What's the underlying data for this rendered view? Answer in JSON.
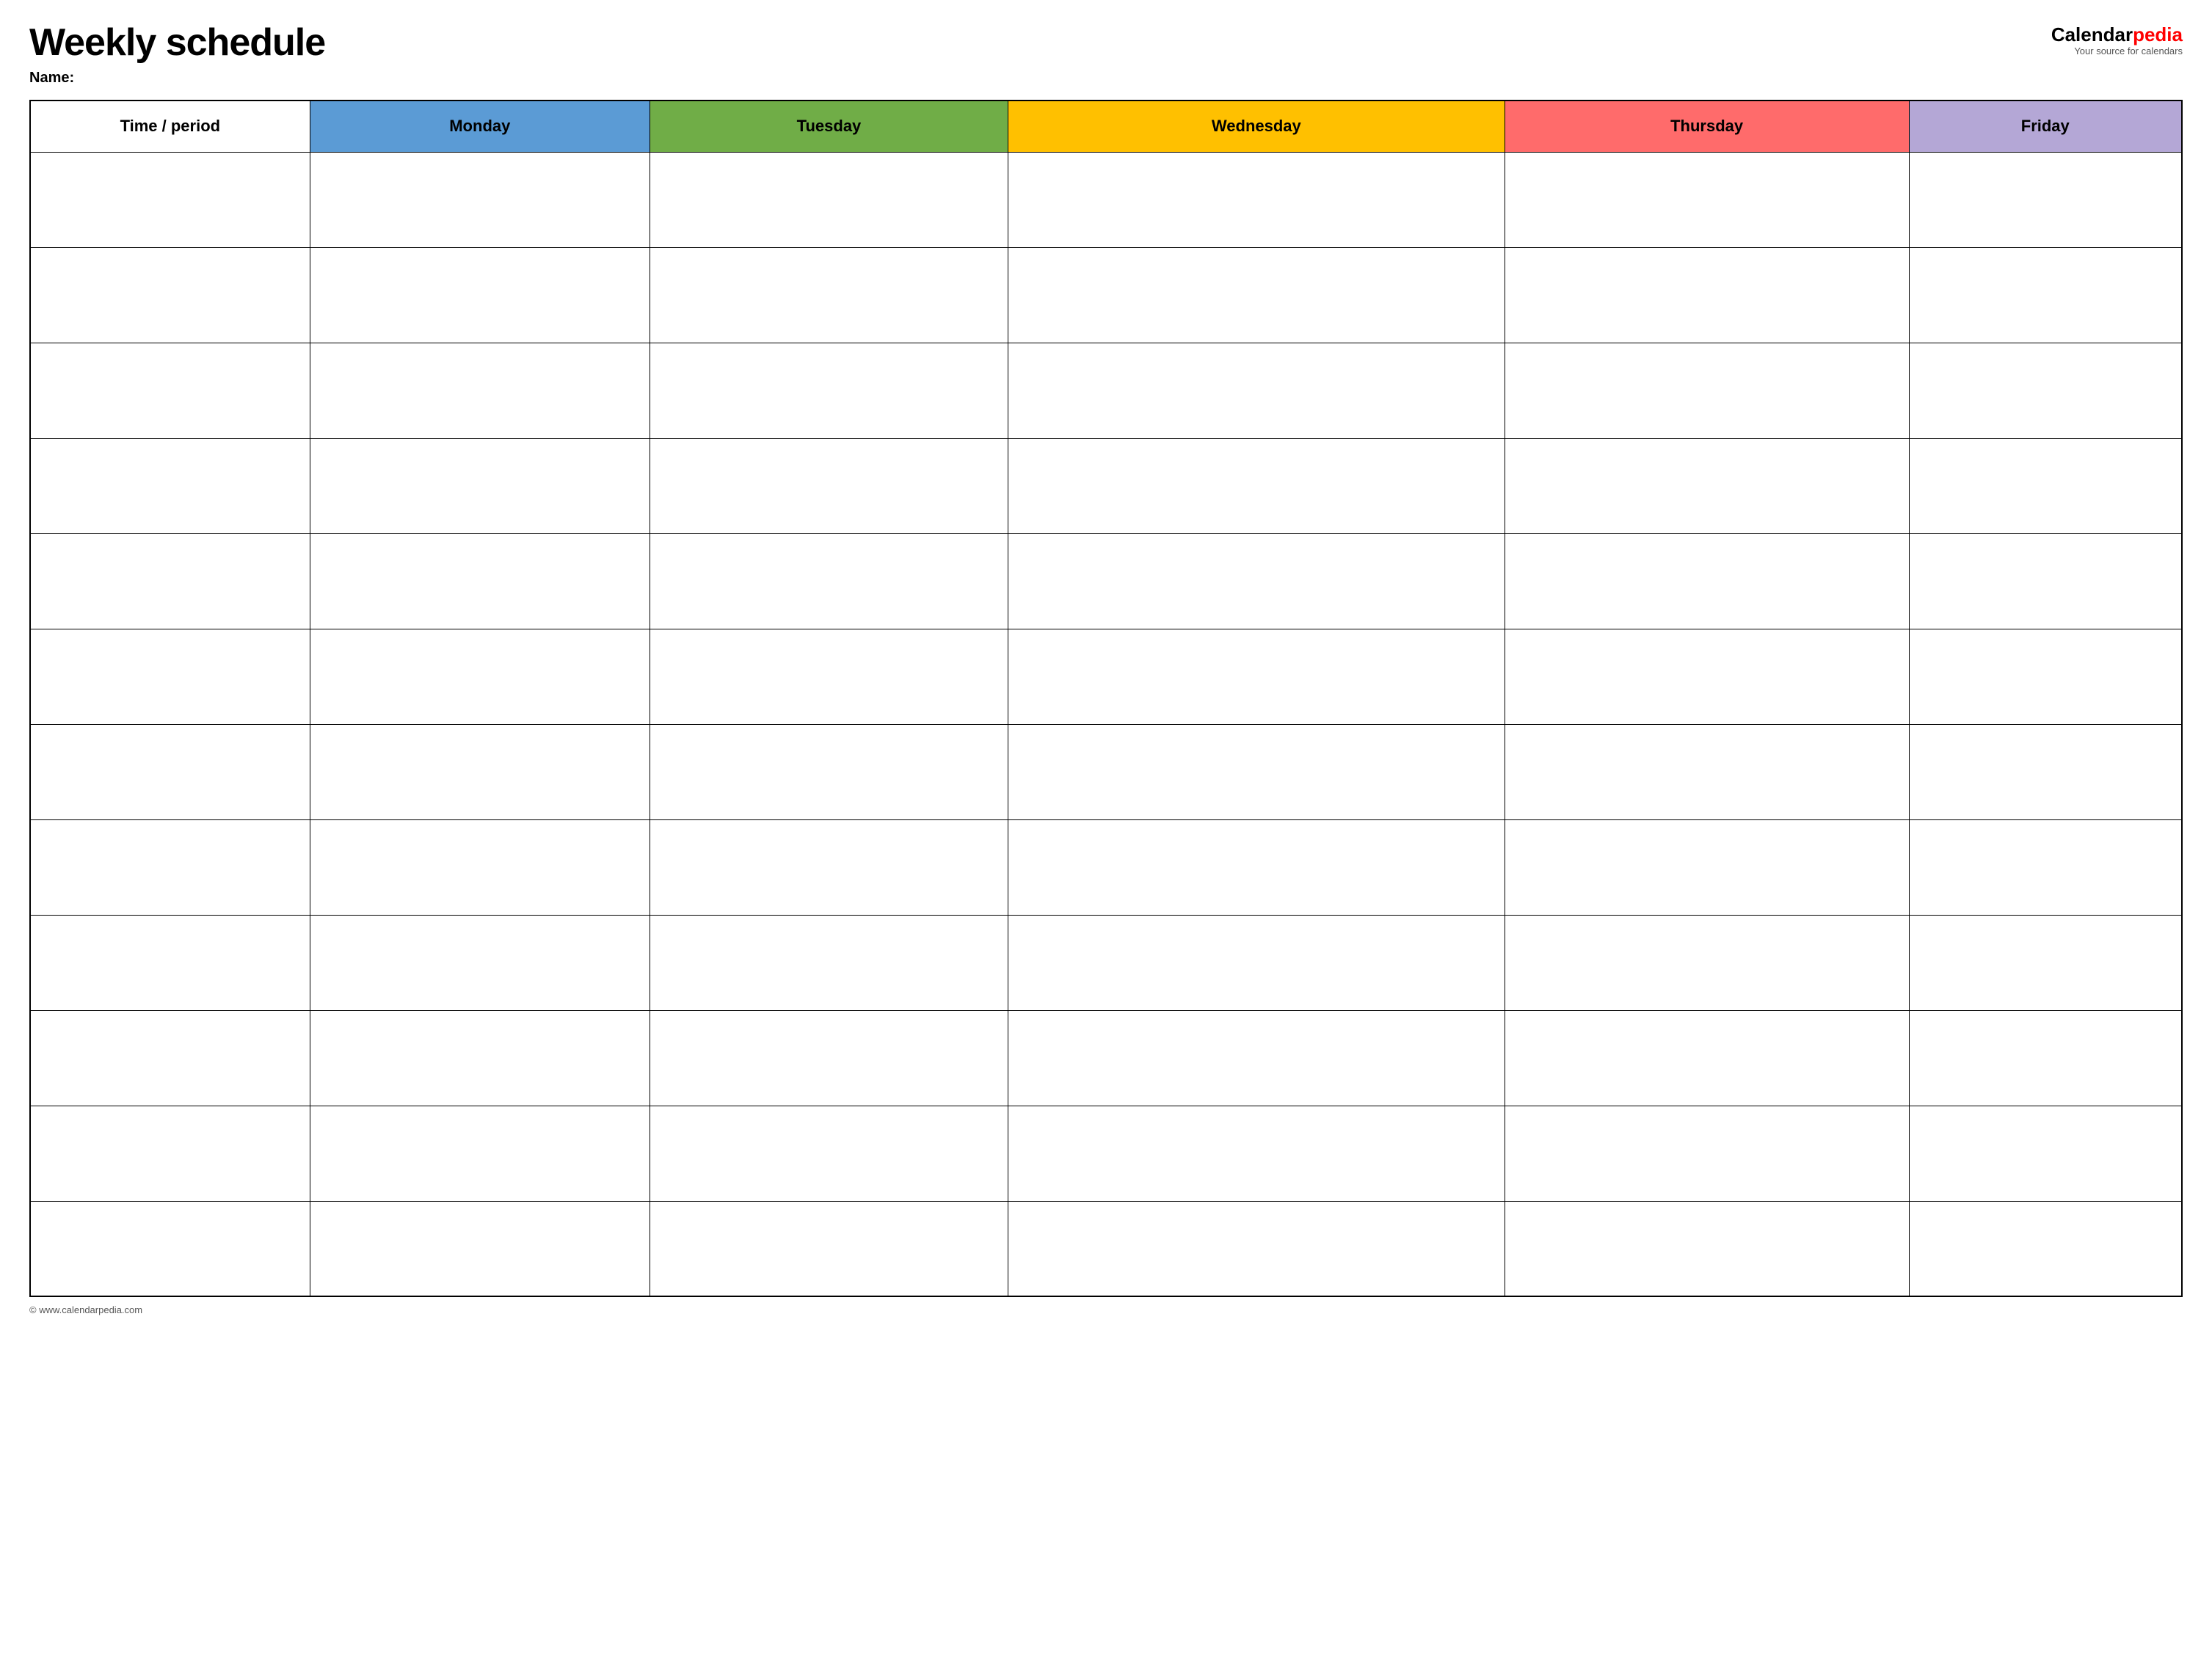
{
  "header": {
    "title": "Weekly schedule",
    "name_label": "Name:",
    "logo": {
      "calendar_part": "Calendar",
      "pedia_part": "pedia",
      "tagline": "Your source for calendars"
    }
  },
  "table": {
    "columns": [
      {
        "id": "time",
        "label": "Time / period",
        "color": "#ffffff"
      },
      {
        "id": "monday",
        "label": "Monday",
        "color": "#5b9bd5"
      },
      {
        "id": "tuesday",
        "label": "Tuesday",
        "color": "#70ad47"
      },
      {
        "id": "wednesday",
        "label": "Wednesday",
        "color": "#ffc000"
      },
      {
        "id": "thursday",
        "label": "Thursday",
        "color": "#ff6b6b"
      },
      {
        "id": "friday",
        "label": "Friday",
        "color": "#b4a7d6"
      }
    ],
    "row_count": 12
  },
  "footer": {
    "url": "© www.calendarpedia.com"
  }
}
